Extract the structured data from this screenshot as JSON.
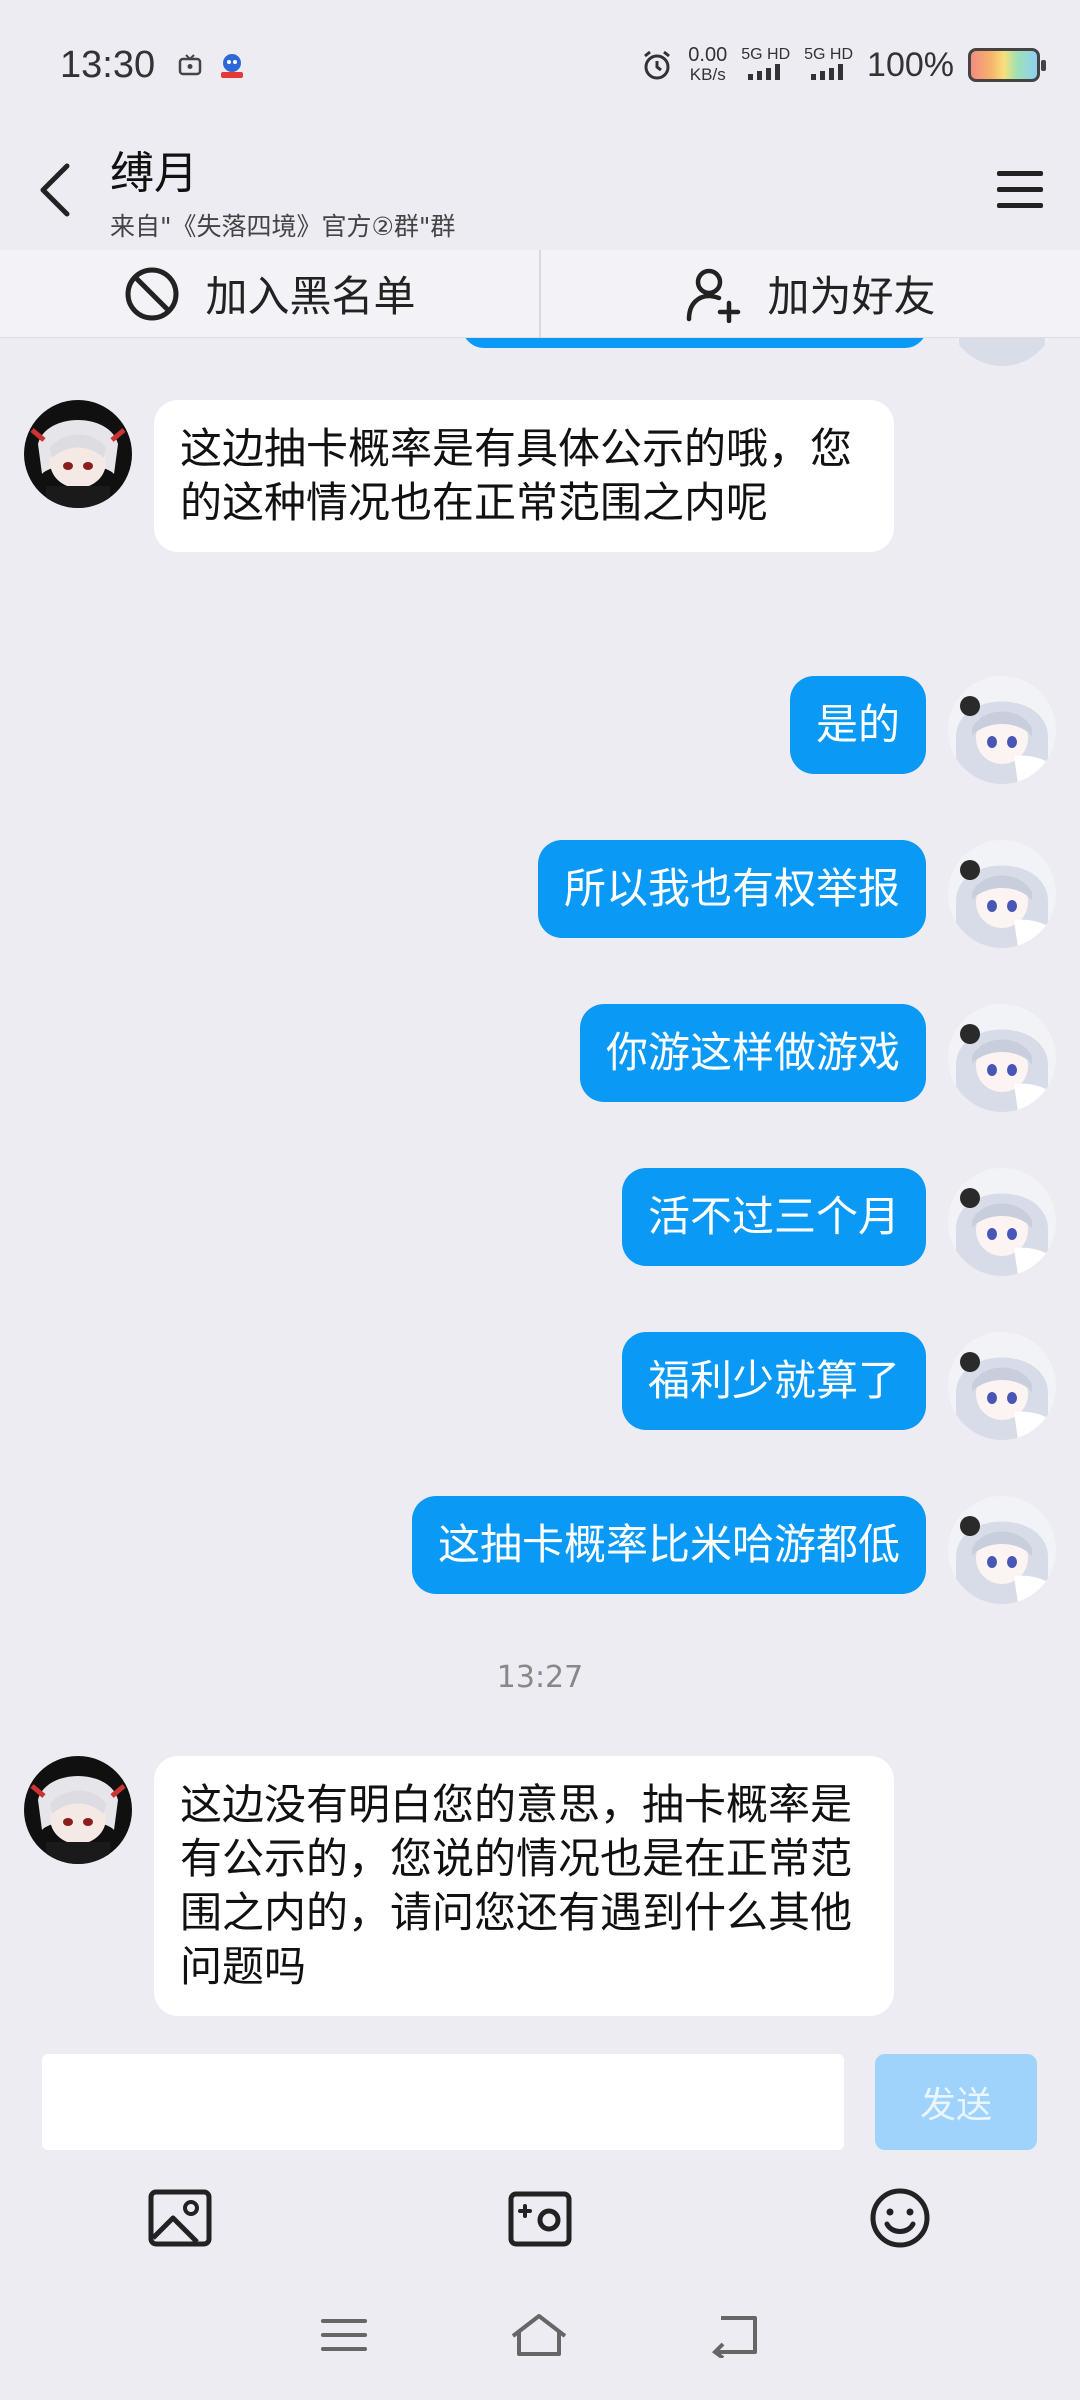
{
  "status_bar": {
    "time": "13:30",
    "speed_value": "0.00",
    "speed_unit": "KB/s",
    "sig1": "5G HD",
    "sig2": "5G HD",
    "battery": "100%"
  },
  "header": {
    "title": "缚月",
    "subtitle": "来自\"《失落四境》官方②群\"群"
  },
  "actions": {
    "block_label": "加入黑名单",
    "add_friend_label": "加为好友"
  },
  "messages": [
    {
      "side": "left",
      "text": "这边抽卡概率是有具体公示的哦，您的这种情况也在正常范围之内呢"
    },
    {
      "side": "right",
      "text": "是的"
    },
    {
      "side": "right",
      "text": "所以我也有权举报"
    },
    {
      "side": "right",
      "text": "你游这样做游戏"
    },
    {
      "side": "right",
      "text": "活不过三个月"
    },
    {
      "side": "right",
      "text": "福利少就算了"
    },
    {
      "side": "right",
      "text": "这抽卡概率比米哈游都低"
    },
    {
      "side": "left",
      "text": "这边没有明白您的意思，抽卡概率是有公示的，您说的情况也是在正常范围之内的，请问您还有遇到什么其他问题吗"
    }
  ],
  "timestamp": "13:27",
  "input": {
    "value": "",
    "send_label": "发送"
  },
  "colors": {
    "accent": "#0a99f5",
    "background": "#ececf2",
    "send_disabled": "#9fd3fb"
  }
}
